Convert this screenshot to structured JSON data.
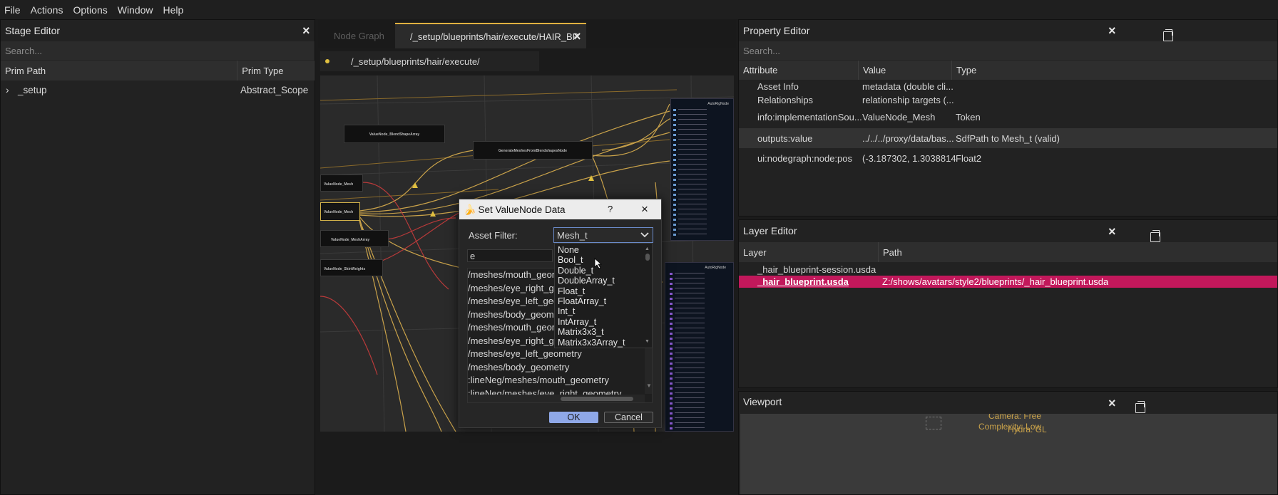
{
  "menu": [
    "File",
    "Actions",
    "Options",
    "Window",
    "Help"
  ],
  "stage_editor": {
    "title": "Stage Editor",
    "search_placeholder": "Search...",
    "col_prim_path": "Prim Path",
    "col_prim_type": "Prim Type",
    "rows": [
      {
        "path": "_setup",
        "type": "Abstract_Scope"
      }
    ]
  },
  "node_graph": {
    "tab_inactive": "Node Graph",
    "tab_active": "/_setup/blueprints/hair/execute/HAIR_BP",
    "breadcrumb": "/_setup/blueprints/hair/execute/",
    "nodes": [
      "ValueNode_BlendShapeArray",
      "GenerateMeshesFromBlendshapesNode",
      "ValueNode_Mesh",
      "ValueNode_MeshArray",
      "ValueNode_SkinWeights",
      "AutoRigNode",
      "AutoRigNode"
    ]
  },
  "dialog": {
    "title": "Set ValueNode Data",
    "help": "?",
    "asset_filter_label": "Asset Filter:",
    "asset_filter_value": "Mesh_t",
    "search_value": "e",
    "dropdown_options": [
      "None",
      "Bool_t",
      "Double_t",
      "DoubleArray_t",
      "Float_t",
      "FloatArray_t",
      "Int_t",
      "IntArray_t",
      "Matrix3x3_t",
      "Matrix3x3Array_t"
    ],
    "results": [
      "/meshes/mouth_geom",
      "/meshes/eye_right_ge",
      "/meshes/eye_left_geo",
      "/meshes/body_geome",
      "/meshes/mouth_geom",
      "/meshes/eye_right_ge",
      "/meshes/eye_left_geometry",
      "/meshes/body_geometry",
      ":lineNeg/meshes/mouth_geometry",
      ":lineNeg/meshes/eye_right_geometry"
    ],
    "ok_label": "OK",
    "cancel_label": "Cancel"
  },
  "property_editor": {
    "title": "Property Editor",
    "search_placeholder": "Search...",
    "col_attribute": "Attribute",
    "col_value": "Value",
    "col_type": "Type",
    "rows": [
      {
        "attribute": "Asset Info",
        "value": "metadata (double cli...",
        "type": ""
      },
      {
        "attribute": "Relationships",
        "value": "relationship targets (...",
        "type": ""
      },
      {
        "attribute": "info:implementationSou...",
        "value": "ValueNode_Mesh",
        "type": "Token"
      },
      {
        "attribute": "outputs:value",
        "value": "../../../proxy/data/bas...",
        "type": "SdfPath to Mesh_t (valid)"
      },
      {
        "attribute": "ui:nodegraph:node:pos",
        "value": "(-3.187302, 1.3038814)",
        "type": "Float2"
      }
    ]
  },
  "layer_editor": {
    "title": "Layer Editor",
    "col_layer": "Layer",
    "col_path": "Path",
    "rows": [
      {
        "layer": "_hair_blueprint-session.usda",
        "path": ""
      },
      {
        "layer": "_hair_blueprint.usda",
        "path": "Z:/shows/avatars/style2/blueprints/_hair_blueprint.usda"
      }
    ],
    "selected_color": "#c2185b"
  },
  "viewport": {
    "title": "Viewport",
    "camera_text": "Camera: Free",
    "complexity_text": "Complexity: Low",
    "renderer_text": "Hydra: GL"
  },
  "colors": {
    "accent": "#c2185b",
    "ok_button": "#8fa8e8",
    "warning_line": "#e0b040"
  }
}
